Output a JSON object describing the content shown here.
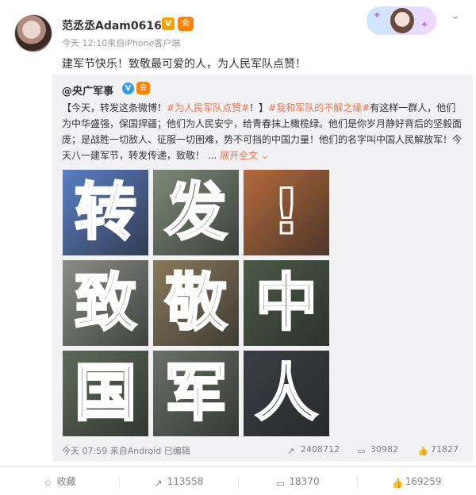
{
  "header": {
    "username": "范丞丞Adam0616",
    "vip_badge": "V",
    "member_badge": "会",
    "meta": "今天 12:10来自iPhone客户端",
    "post_text": "建军节快乐！致敬最可爱的人，为人民军队点赞！"
  },
  "repost": {
    "orig_user": "@央广军事",
    "v_icon": "V",
    "m_icon": "会",
    "text_parts": {
      "p1": "【今天，转发这条微博！",
      "topic1": "#为人民军队点赞#",
      "p2": "！】",
      "topic2": "#我和军队的不解之缘#",
      "p3": "有这样一群人，他们为中华盛强，保国捍疆；他们为人民安宁，给青春抹上橄榄绿。他们是你岁月静好背后的坚毅面庞；是战胜一切敌人、征服一切困难，势不可挡的中国力量！他们的名字叫中国人民解放军！今天八一建军节，转发传递，致敬！ ...",
      "more": "展开全文 ⌄"
    },
    "tiles": [
      {
        "char": "转",
        "bg": "#5a7fc7"
      },
      {
        "char": "发",
        "bg": "#7d8a78"
      },
      {
        "char": "!",
        "bg": "#b46a3c"
      },
      {
        "char": "致",
        "bg": "#8a8f86"
      },
      {
        "char": "敬",
        "bg": "#8a7a5a"
      },
      {
        "char": "中",
        "bg": "#4a5a46"
      },
      {
        "char": "国",
        "bg": "#5d6b58"
      },
      {
        "char": "军",
        "bg": "#6a7068"
      },
      {
        "char": "人",
        "bg": "#3a3d44"
      }
    ],
    "footer_meta": "今天 07:59 来自Android  已编辑",
    "stats": {
      "forward": "2408712",
      "comment": "30982",
      "like": "71827"
    }
  },
  "actions": {
    "favorite": "收藏",
    "forward": "113558",
    "comment": "18370",
    "like": "169259"
  },
  "colors": {
    "accent": "#eb7350",
    "vip": "#f7a100",
    "verified": "#2d9cf0"
  }
}
